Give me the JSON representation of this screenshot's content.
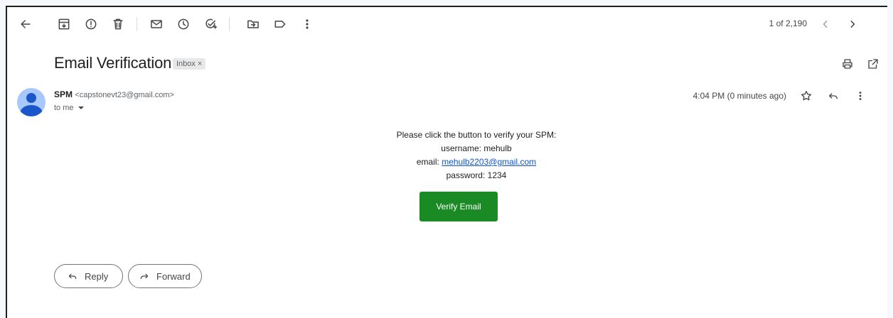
{
  "toolbar": {
    "icons": [
      "back-arrow-icon",
      "archive-icon",
      "report-spam-icon",
      "delete-icon",
      "mark-unread-icon",
      "snooze-icon",
      "add-task-icon",
      "move-to-icon",
      "label-icon",
      "more-vert-icon"
    ],
    "pager_text": "1 of 2,190"
  },
  "email": {
    "subject": "Email Verification",
    "label_chip": "Inbox",
    "label_close": "×",
    "sender_name": "SPM",
    "sender_address": "<capstonevt23@gmail.com>",
    "to_text": "to me",
    "timestamp": "4:04 PM (0 minutes ago)"
  },
  "message": {
    "line1": "Please click the button to verify your SPM:",
    "line2": "username: mehulb",
    "line3_prefix": "email: ",
    "line3_link": "mehulb2203@gmail.com",
    "line4": "password: 1234",
    "button_label": "Verify Email",
    "button_color": "#1a8a24"
  },
  "actions": {
    "reply_label": "Reply",
    "forward_label": "Forward"
  }
}
